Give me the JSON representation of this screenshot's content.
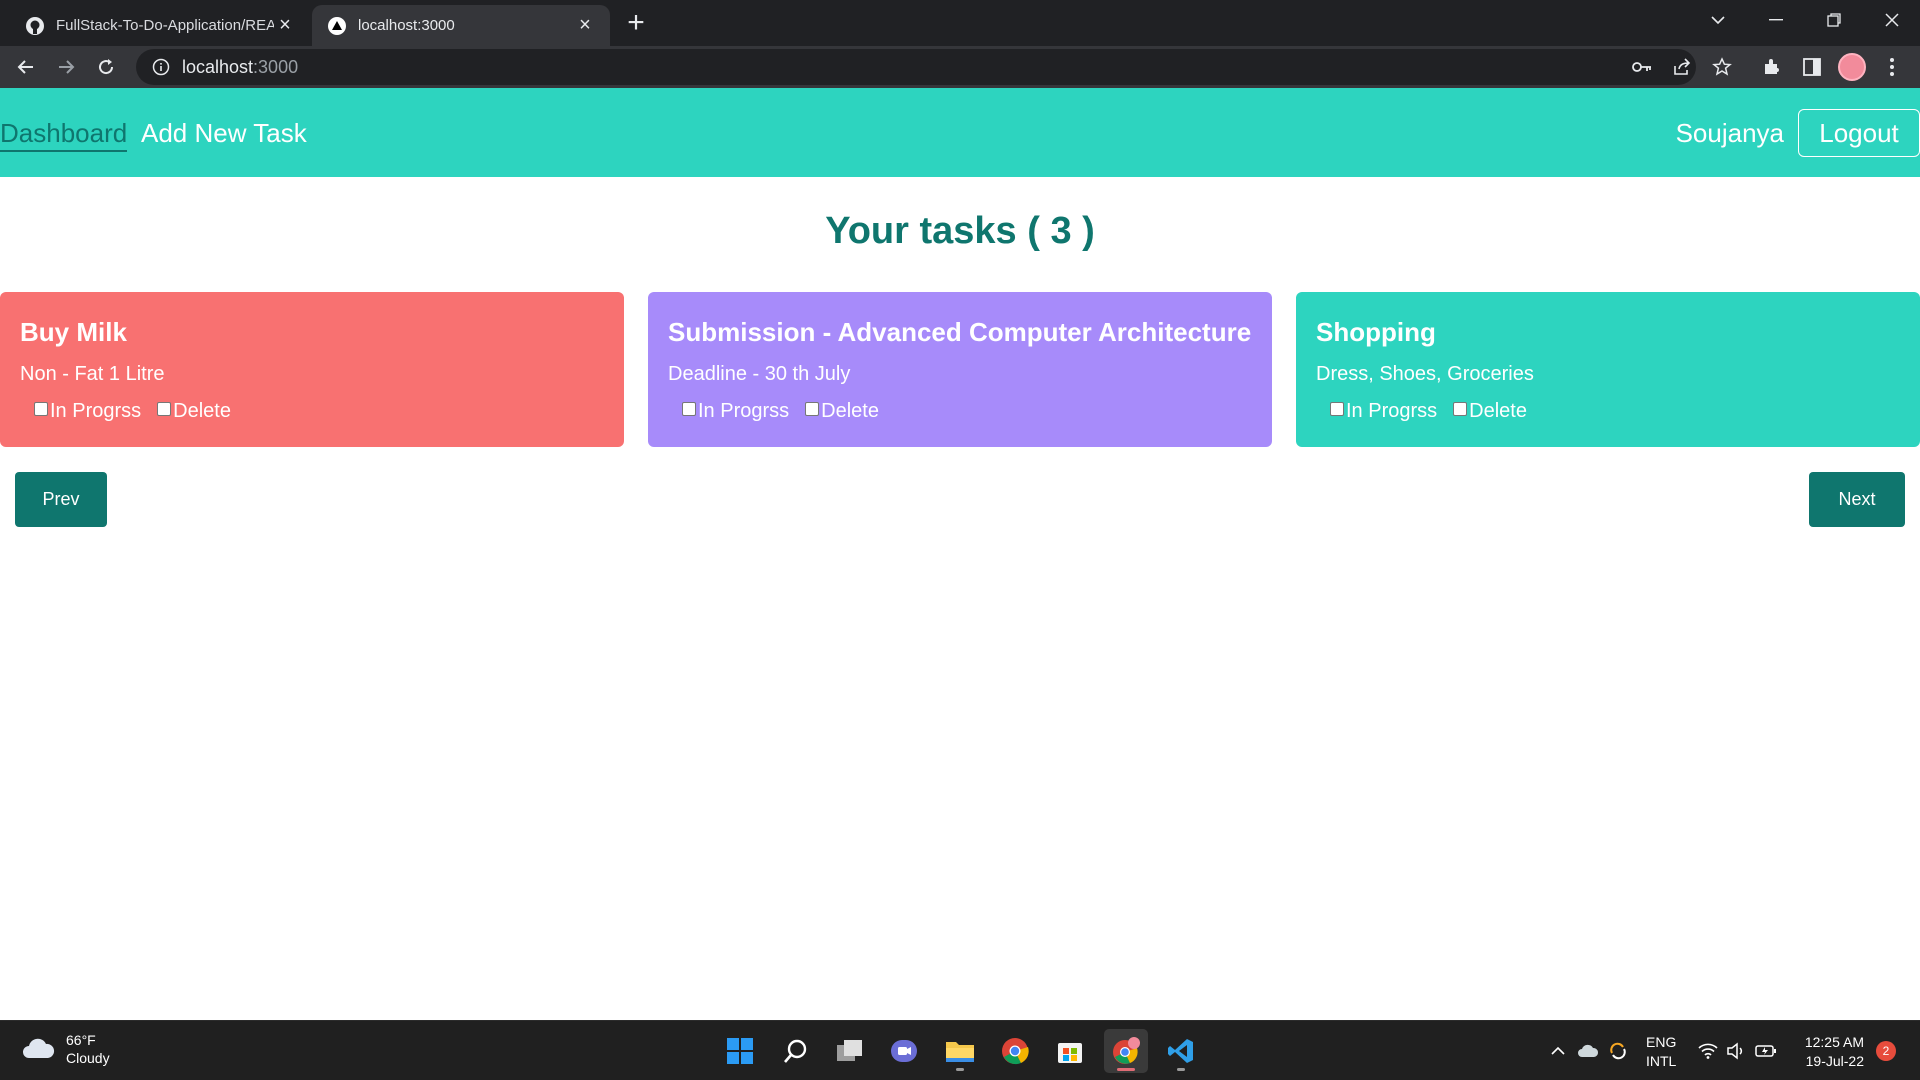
{
  "browser": {
    "tabs": [
      {
        "title": "FullStack-To-Do-Application/REA",
        "icon": "github-icon",
        "active": false
      },
      {
        "title": "localhost:3000",
        "icon": "triangle-icon",
        "active": true
      }
    ],
    "url_host": "localhost",
    "url_port": ":3000"
  },
  "app": {
    "nav": {
      "dashboard": "Dashboard",
      "add_new_task": "Add New Task",
      "user": "Soujanya",
      "logout": "Logout"
    },
    "heading": "Your tasks ( 3 )",
    "tasks": [
      {
        "title": "Buy Milk",
        "description": "Non - Fat 1 Litre",
        "color": "#f87171",
        "in_progress_label": "In Progrss",
        "delete_label": "Delete"
      },
      {
        "title": "Submission - Advanced Computer Architecture",
        "description": "Deadline - 30 th July",
        "color": "#a78bfa",
        "in_progress_label": "In Progrss",
        "delete_label": "Delete"
      },
      {
        "title": "Shopping",
        "description": "Dress, Shoes, Groceries",
        "color": "#2dd4bf",
        "in_progress_label": "In Progrss",
        "delete_label": "Delete"
      }
    ],
    "prev": "Prev",
    "next": "Next",
    "colors": {
      "navbar": "#2dd4bf",
      "accent": "#0f766e"
    }
  },
  "taskbar": {
    "weather_temp": "66°F",
    "weather_desc": "Cloudy",
    "lang_top": "ENG",
    "lang_bottom": "INTL",
    "time": "12:25 AM",
    "date": "19-Jul-22",
    "notifications": "2"
  }
}
